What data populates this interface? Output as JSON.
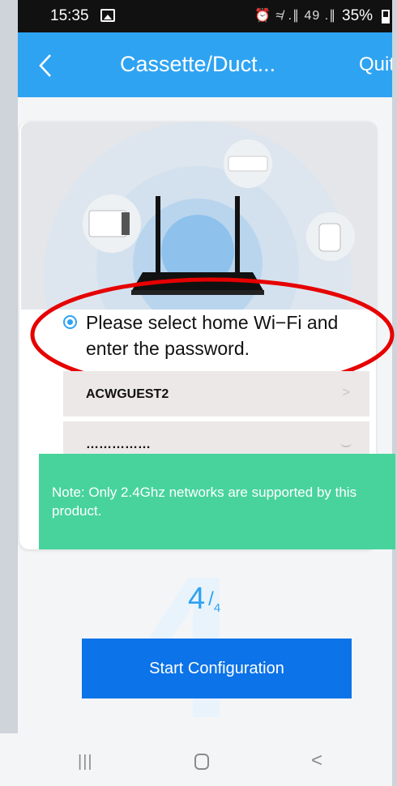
{
  "status_bar": {
    "time": "15:35",
    "system_icons": "⏰ ≉ .∥ 49 .∥",
    "battery": "35%"
  },
  "header": {
    "title": "Cassette/Duct...",
    "quit_label": "Quit",
    "back_icon": "chevron-left-icon"
  },
  "illustration": {
    "description_icon": "router-with-devices-illustration"
  },
  "instruction": {
    "text": "Please select home Wi−Fi and enter the password."
  },
  "wifi": {
    "ssid": "ACWGUEST2",
    "password_mask": "……………"
  },
  "note": {
    "text": "Note: Only 2.4Ghz networks are supported by this product."
  },
  "progress": {
    "current": "4",
    "separator": "/",
    "total": "4",
    "background_digit": "4"
  },
  "actions": {
    "start_label": "Start Configuration"
  },
  "colors": {
    "app_bar": "#2ea3f2",
    "button": "#0c73e8",
    "note_bg": "#48d39d",
    "highlight": "#e60000"
  }
}
